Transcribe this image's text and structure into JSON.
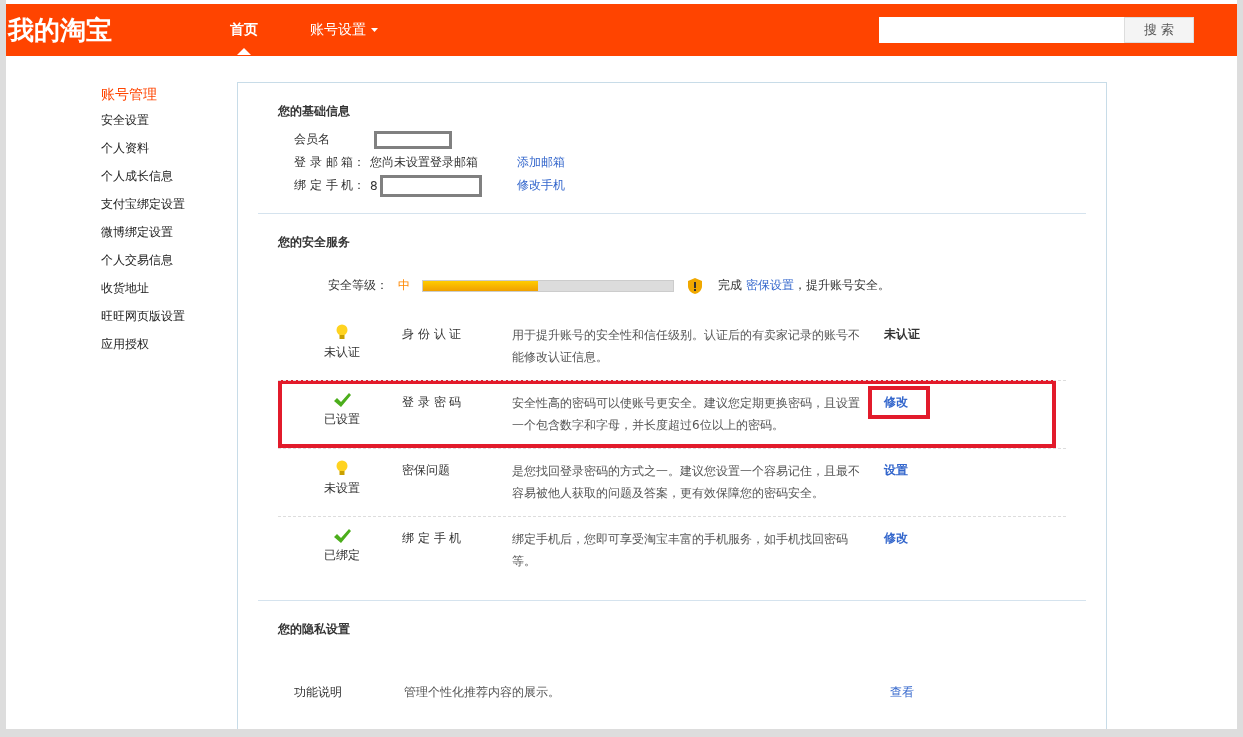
{
  "header": {
    "logo": "我的淘宝",
    "nav": [
      {
        "label": "首页",
        "selected": true,
        "dropdown": false
      },
      {
        "label": "账号设置",
        "selected": false,
        "dropdown": true
      }
    ],
    "search_button": "搜 索"
  },
  "sidebar": {
    "title": "账号管理",
    "items": [
      "安全设置",
      "个人资料",
      "个人成长信息",
      "支付宝绑定设置",
      "微博绑定设置",
      "个人交易信息",
      "收货地址",
      "旺旺网页版设置",
      "应用授权"
    ]
  },
  "basic_info": {
    "title": "您的基础信息",
    "rows": [
      {
        "label": "会员名",
        "value": "",
        "redacted": true,
        "link": ""
      },
      {
        "label": "登 录 邮 箱：",
        "value": "您尚未设置登录邮箱",
        "redacted": false,
        "link": "添加邮箱"
      },
      {
        "label": "绑 定 手 机：",
        "value": "8",
        "redacted": true,
        "link": "修改手机"
      }
    ]
  },
  "security": {
    "title": "您的安全服务",
    "level_label": "安全等级：",
    "level_text": "中",
    "level": 0.46,
    "hint_before": "完成",
    "hint_link": "密保设置",
    "hint_after": "，提升账号安全。",
    "services": [
      {
        "status": {
          "kind": "bulb",
          "text": "未认证"
        },
        "name": "身 份 认 证",
        "description": "用于提升账号的安全性和信任级别。认证后的有卖家记录的账号不能修改认证信息。",
        "action": {
          "kind": "text",
          "text": "未认证"
        },
        "highlighted": false
      },
      {
        "status": {
          "kind": "check",
          "text": "已设置"
        },
        "name": "登 录 密 码",
        "description": "安全性高的密码可以使账号更安全。建议您定期更换密码，且设置一个包含数字和字母，并长度超过6位以上的密码。",
        "action": {
          "kind": "link",
          "text": "修改"
        },
        "highlighted": true
      },
      {
        "status": {
          "kind": "bulb",
          "text": "未设置"
        },
        "name": "密保问题",
        "description": "是您找回登录密码的方式之一。建议您设置一个容易记住，且最不容易被他人获取的问题及答案，更有效保障您的密码安全。",
        "action": {
          "kind": "link",
          "text": "设置"
        },
        "highlighted": false
      },
      {
        "status": {
          "kind": "check",
          "text": "已绑定"
        },
        "name": "绑 定 手 机",
        "description": "绑定手机后，您即可享受淘宝丰富的手机服务，如手机找回密码等。",
        "action": {
          "kind": "link",
          "text": "修改"
        },
        "highlighted": false
      }
    ]
  },
  "privacy": {
    "title": "您的隐私设置",
    "rows": [
      {
        "name": "功能说明",
        "description": "管理个性化推荐内容的展示。",
        "action": "查看"
      }
    ]
  }
}
